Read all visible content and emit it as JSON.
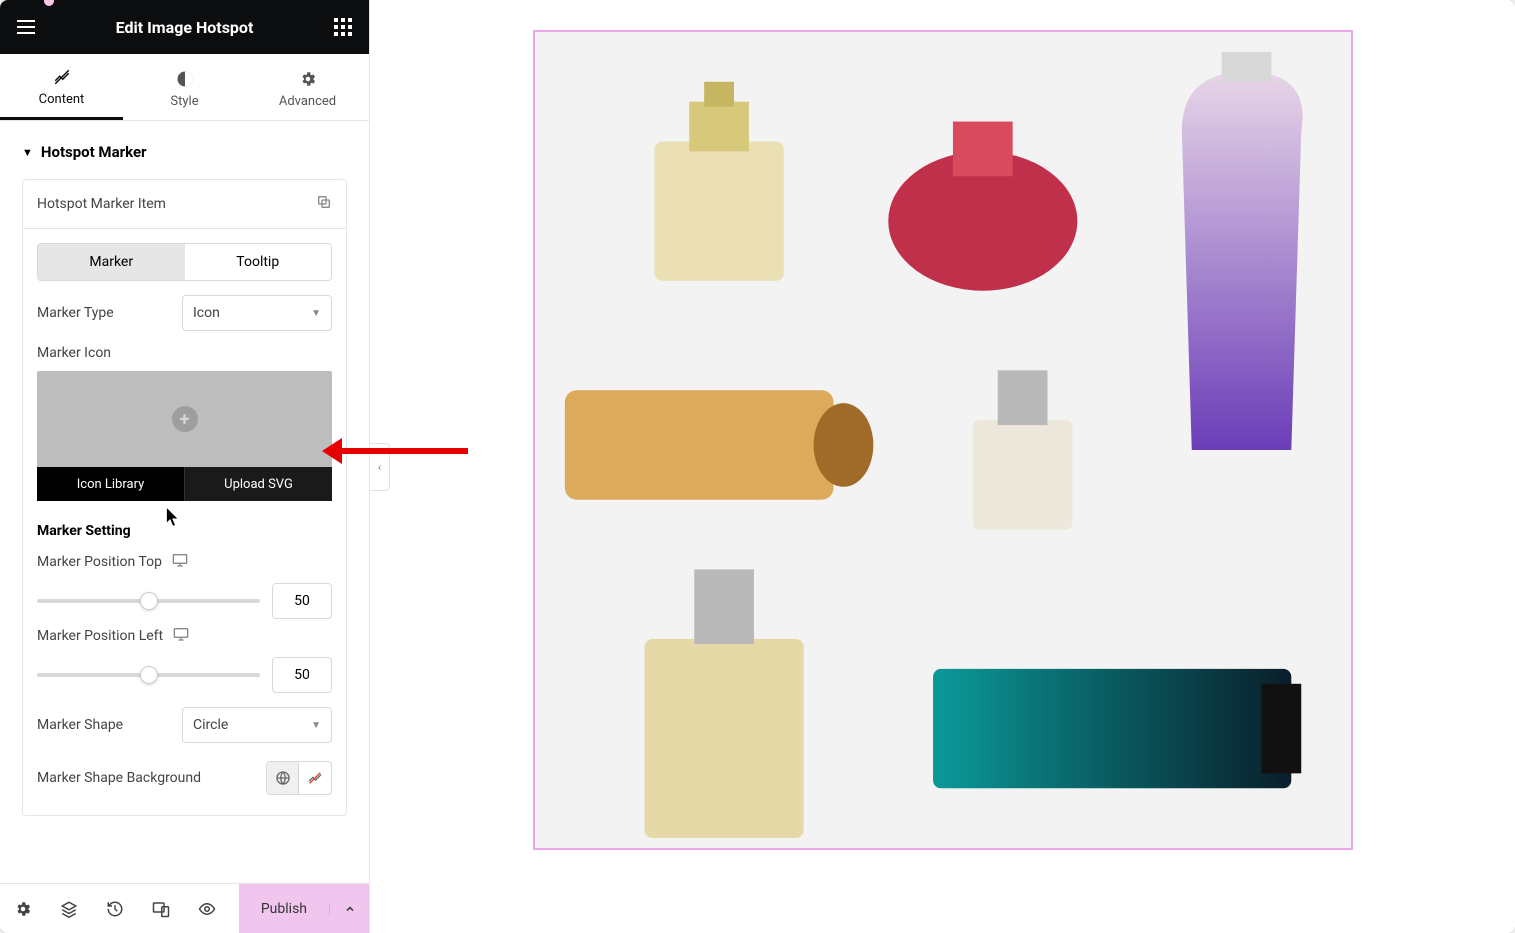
{
  "header": {
    "title": "Edit Image Hotspot"
  },
  "tabs": {
    "content": "Content",
    "style": "Style",
    "advanced": "Advanced"
  },
  "section": {
    "title": "Hotspot Marker"
  },
  "item": {
    "title": "Hotspot Marker Item"
  },
  "inner_tabs": {
    "marker": "Marker",
    "tooltip": "Tooltip"
  },
  "marker_type": {
    "label": "Marker Type",
    "value": "Icon"
  },
  "marker_icon": {
    "label": "Marker Icon",
    "icon_library": "Icon Library",
    "upload_svg": "Upload SVG"
  },
  "marker_setting": {
    "heading": "Marker Setting",
    "pos_top_label": "Marker Position Top",
    "pos_top_value": "50",
    "pos_left_label": "Marker Position Left",
    "pos_left_value": "50",
    "shape_label": "Marker Shape",
    "shape_value": "Circle",
    "shape_bg_label": "Marker Shape Background"
  },
  "footer": {
    "publish": "Publish"
  }
}
